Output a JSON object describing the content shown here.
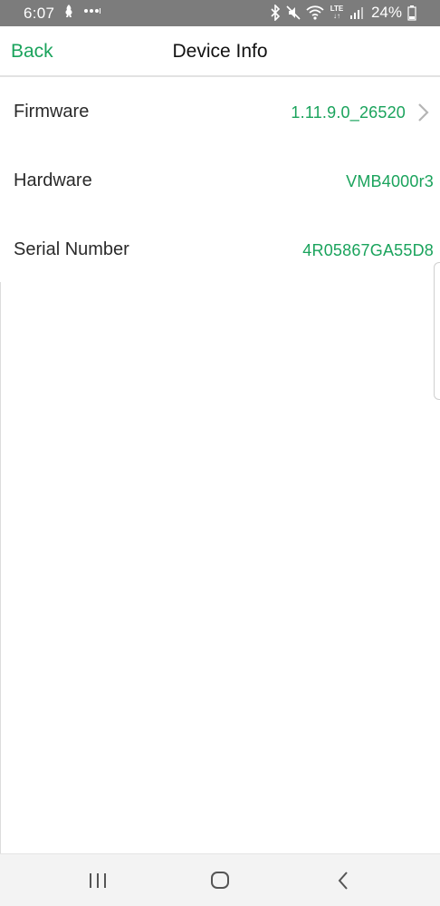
{
  "status_bar": {
    "time": "6:07",
    "lte_label": "LTE",
    "battery_percent": "24%",
    "background_color": "#7c7c7c"
  },
  "header": {
    "back_label": "Back",
    "title": "Device Info"
  },
  "info_rows": [
    {
      "label": "Firmware",
      "value": "1.11.9.0_26520",
      "has_chevron": true
    },
    {
      "label": "Hardware",
      "value": "VMB4000r3",
      "has_chevron": false
    },
    {
      "label": "Serial Number",
      "value": "4R05867GA55D8",
      "has_chevron": false
    }
  ],
  "colors": {
    "accent": "#1aa35c",
    "text": "#2a2a2a"
  },
  "nav_bar": {
    "buttons": [
      "recent-apps-icon",
      "home-icon",
      "back-icon"
    ]
  }
}
